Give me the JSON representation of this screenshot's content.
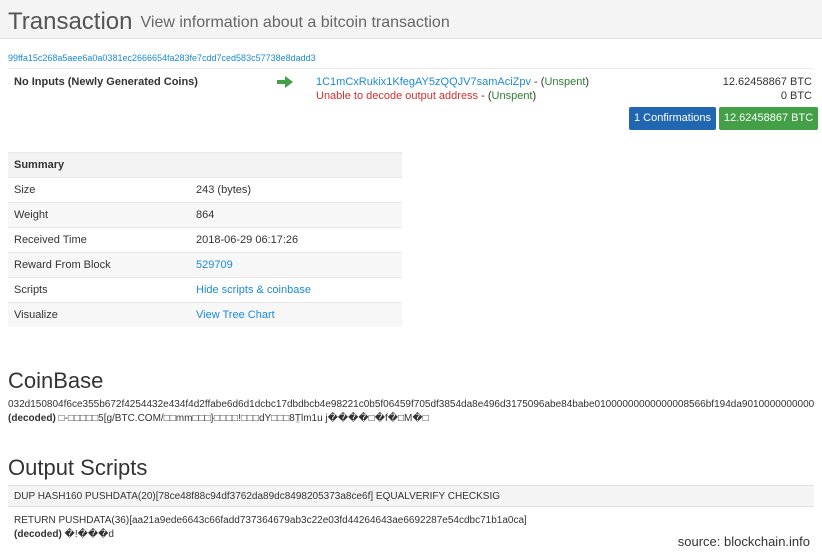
{
  "header": {
    "title": "Transaction",
    "subtitle": "View information about a bitcoin transaction"
  },
  "tx": {
    "hash": "99ffa15c268a5aee6a0a0381ec2666654fa283fe7cdd7ced583c57738e8dadd3",
    "inputs_label": "No Inputs (Newly Generated Coins)",
    "outputs": [
      {
        "address": "1C1mCxRukix1KfegAY5zQQJV7samAciZpv",
        "sep": " - (",
        "status": "Unspent",
        "close": ")",
        "amount": "12.62458867 BTC"
      },
      {
        "address": "Unable to decode output address",
        "sep": " - (",
        "status": "Unspent",
        "close": ")",
        "amount": "0 BTC"
      }
    ],
    "confirmations_label": "1 Confirmations",
    "total_label": "12.62458867 BTC"
  },
  "colors": {
    "accent_blue": "#2166b0",
    "accent_green": "#43a047",
    "link": "#1a8bd6",
    "error": "#d32f2f"
  },
  "summary": {
    "heading": "Summary",
    "rows": [
      {
        "key": "Size",
        "value": "243 (bytes)"
      },
      {
        "key": "Weight",
        "value": "864"
      },
      {
        "key": "Received Time",
        "value": "2018-06-29 06:17:26"
      },
      {
        "key": "Reward From Block",
        "value": "529709"
      },
      {
        "key": "Scripts",
        "value": "Hide scripts & coinbase"
      },
      {
        "key": "Visualize",
        "value": "View Tree Chart"
      }
    ]
  },
  "coinbase": {
    "heading": "CoinBase",
    "hex": "032d150804f6ce355b672f4254432e434f4d2ffabe6d6d1dcbc17dbdbcb4e98221c0b5f06459f705df3854da8e496d3175096abe84babe01000000000000008566bf194da9010000000000",
    "decoded_label": "(decoded)",
    "decoded": " □-□□□□□5[g/BTC.COM/□□mm□□□}□□□□!□□□dY□□□8T̤lm1u j����□�f�□M�□"
  },
  "output_scripts": {
    "heading": "Output Scripts",
    "script1": "DUP HASH160 PUSHDATA(20)[78ce48f88c94df3762da89dc8498205373a8ce6f] EQUALVERIFY CHECKSIG",
    "script2": "RETURN PUSHDATA(36)[aa21a9ede6643c66fadd737364679ab3c22e03fd44264643ae6692287e54cdbc71b1a0ca]",
    "decoded_label": "(decoded)",
    "decoded": " �!���d"
  },
  "source": "source: blockchain.info"
}
